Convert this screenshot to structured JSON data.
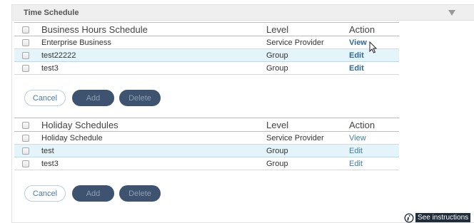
{
  "panel": {
    "title": "Time Schedule"
  },
  "business": {
    "headers": {
      "name": "Business Hours Schedule",
      "level": "Level",
      "action": "Action"
    },
    "rows": [
      {
        "name": "Enterprise Business",
        "level": "Service Provider",
        "action": "View",
        "selected": false
      },
      {
        "name": "test22222",
        "level": "Group",
        "action": "Edit",
        "selected": true
      },
      {
        "name": "test3",
        "level": "Group",
        "action": "Edit",
        "selected": false
      }
    ],
    "buttons": {
      "cancel": "Cancel",
      "add": "Add",
      "delete": "Delete"
    }
  },
  "holiday": {
    "headers": {
      "name": "Holiday Schedules",
      "level": "Level",
      "action": "Action"
    },
    "rows": [
      {
        "name": "Holiday Schedule",
        "level": "Service Provider",
        "action": "View",
        "selected": false
      },
      {
        "name": "test",
        "level": "Group",
        "action": "Edit",
        "selected": true
      },
      {
        "name": "test3",
        "level": "Group",
        "action": "Edit",
        "selected": false
      }
    ],
    "buttons": {
      "cancel": "Cancel",
      "add": "Add",
      "delete": "Delete"
    }
  },
  "footer": {
    "instructions_label": "See instructions"
  },
  "icons": {
    "collapse": "triangle-down-icon",
    "info": "info-icon",
    "cursor": "mouse-pointer-icon"
  },
  "colors": {
    "link": "#3c7fb1",
    "primary_button": "#3d536f",
    "selected_row": "#e3f4fa"
  }
}
